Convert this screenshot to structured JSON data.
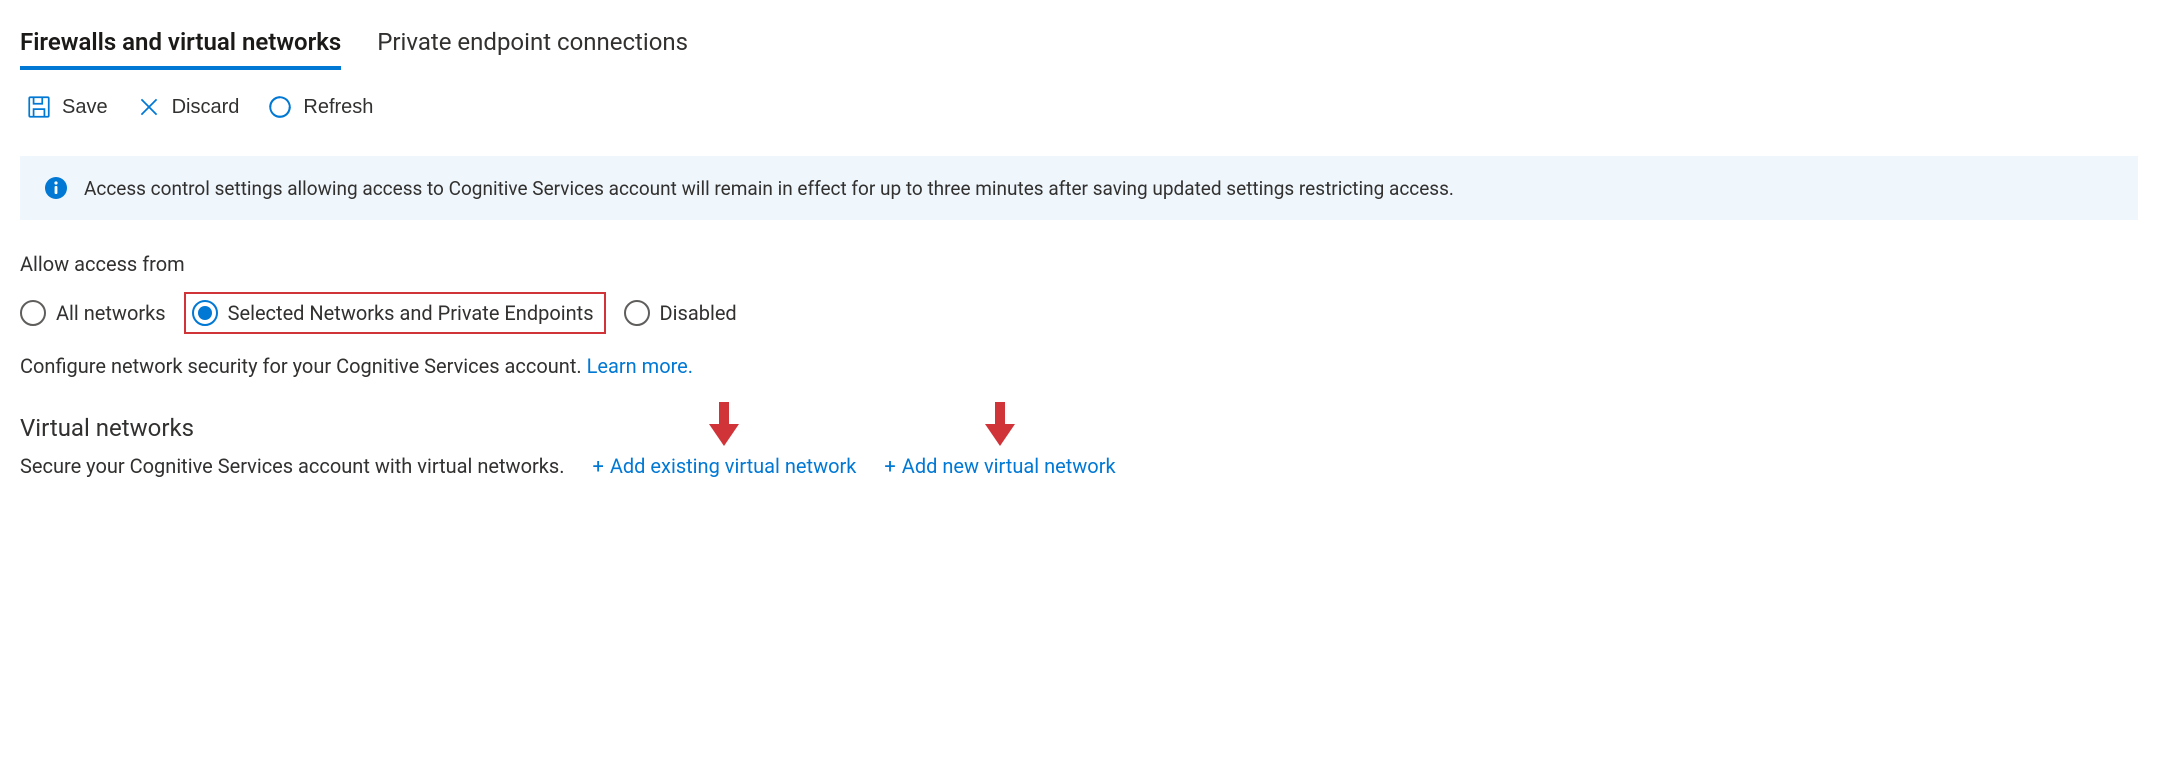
{
  "tabs": {
    "firewalls": "Firewalls and virtual networks",
    "private_endpoints": "Private endpoint connections"
  },
  "toolbar": {
    "save": "Save",
    "discard": "Discard",
    "refresh": "Refresh"
  },
  "info_banner": "Access control settings allowing access to Cognitive Services account will remain in effect for up to three minutes after saving updated settings restricting access.",
  "access": {
    "label": "Allow access from",
    "options": {
      "all": "All networks",
      "selected": "Selected Networks and Private Endpoints",
      "disabled": "Disabled"
    },
    "description": "Configure network security for your Cognitive Services account.",
    "learn_more": "Learn more."
  },
  "vnet": {
    "title": "Virtual networks",
    "description": "Secure your Cognitive Services account with virtual networks.",
    "add_existing": "Add existing virtual network",
    "add_new": "Add new virtual network"
  }
}
